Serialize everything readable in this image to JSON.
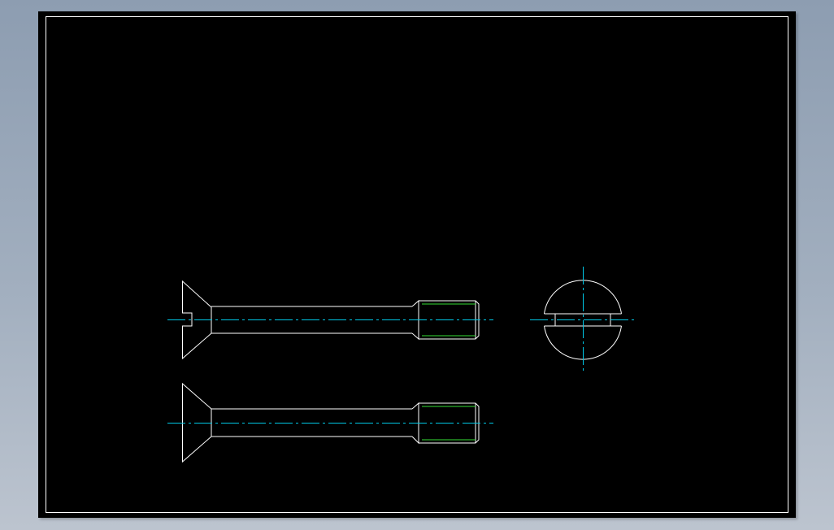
{
  "colors": {
    "viewport_background": "#9aa8ba",
    "sheet_background": "#000000",
    "outline": "#ffffff",
    "centerline": "#00c8e6",
    "thread": "#33dd33"
  },
  "drawing": {
    "title": "",
    "views": [
      {
        "name": "front-view-sectioned",
        "description_visible": false
      },
      {
        "name": "front-view",
        "description_visible": false
      },
      {
        "name": "end-view",
        "description_visible": false
      }
    ]
  }
}
